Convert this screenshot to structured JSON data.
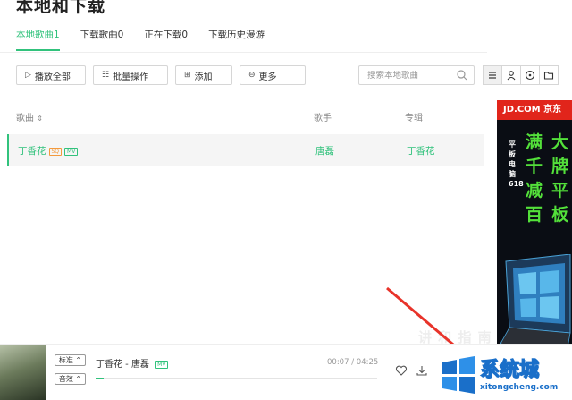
{
  "header": {
    "title": "本地和下载"
  },
  "tabs": [
    {
      "label": "本地歌曲1",
      "active": true
    },
    {
      "label": "下载歌曲0",
      "active": false
    },
    {
      "label": "正在下载0",
      "active": false
    },
    {
      "label": "下载历史漫游",
      "active": false
    }
  ],
  "toolbar": {
    "play_all": "播放全部",
    "batch": "批量操作",
    "add": "添加",
    "more": "更多"
  },
  "search": {
    "placeholder": "搜索本地歌曲"
  },
  "table": {
    "columns": {
      "song": "歌曲",
      "sort_icon": "⇕",
      "artist": "歌手",
      "album": "专辑"
    },
    "rows": [
      {
        "song": "丁香花",
        "badge_quality": "SQ",
        "badge_mv": "MV",
        "artist": "唐磊",
        "album": "丁香花"
      }
    ]
  },
  "ad": {
    "brand": "JD.COM 京东",
    "vertical": "平板电脑618",
    "big_col1": "满千减百",
    "big_col2": "大牌平板",
    "watermark": "讲 和 指 南"
  },
  "player": {
    "quality": "标准",
    "effect": "音效",
    "song": "丁香花 - 唐磊",
    "badge_mv": "MV",
    "time": "00:07 / 04:25",
    "progress": 0.03
  },
  "site_watermark": {
    "name": "系统城",
    "domain": "xitongcheng.com"
  },
  "colors": {
    "accent": "#31c27c",
    "ad_red": "#e1251b",
    "arrow": "#e8332a"
  }
}
